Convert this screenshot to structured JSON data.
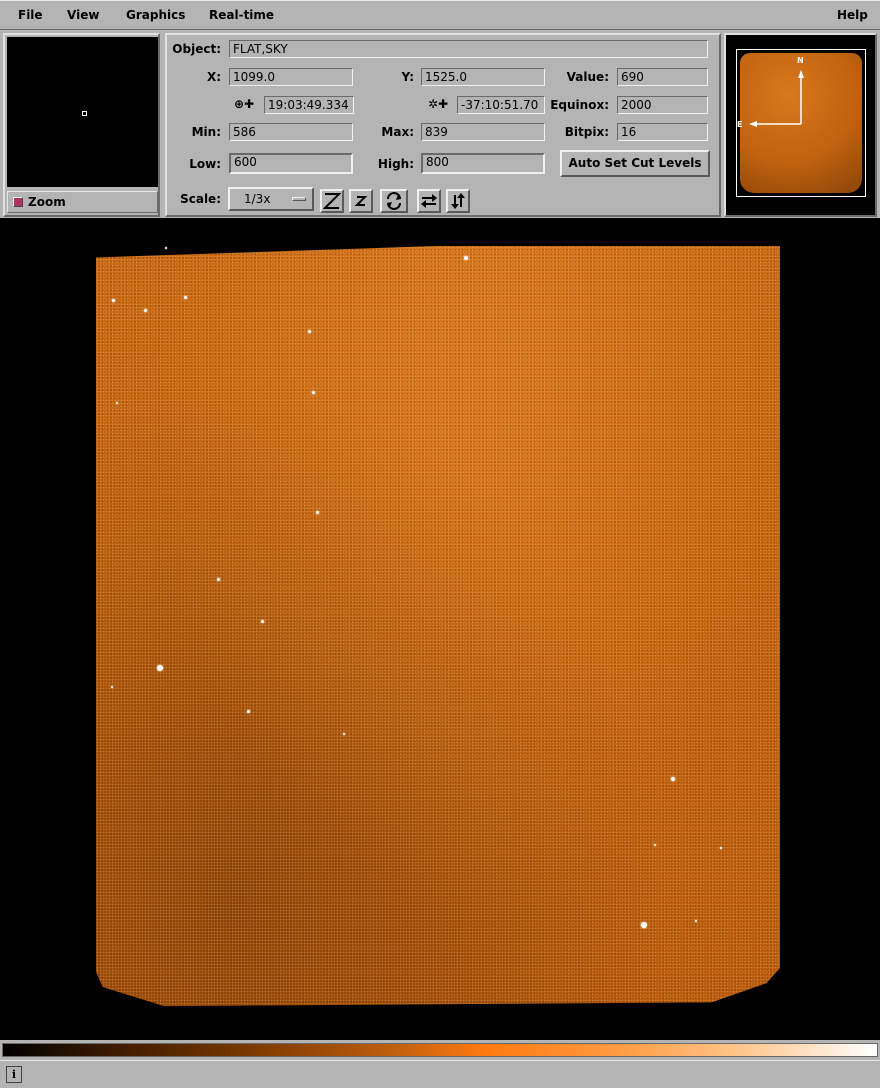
{
  "menu": {
    "file": "File",
    "view": "View",
    "graphics": "Graphics",
    "realtime": "Real-time",
    "help": "Help"
  },
  "zoom": {
    "label": "Zoom",
    "checked": true
  },
  "info": {
    "object_label": "Object:",
    "object_value": "FLAT,SKY",
    "x_label": "X:",
    "x_value": "1099.0",
    "y_label": "Y:",
    "y_value": "1525.0",
    "value_label": "Value:",
    "value_value": "690",
    "ra_value": "19:03:49.334",
    "dec_value": "-37:10:51.70",
    "equinox_label": "Equinox:",
    "equinox_value": "2000",
    "min_label": "Min:",
    "min_value": "586",
    "max_label": "Max:",
    "max_value": "839",
    "bitpix_label": "Bitpix:",
    "bitpix_value": "16",
    "low_label": "Low:",
    "low_value": "600",
    "high_label": "High:",
    "high_value": "800",
    "auto_cut_label": "Auto Set Cut Levels",
    "scale_label": "Scale:",
    "scale_value": "1/3x"
  },
  "panner": {
    "north_label": "N",
    "east_label": "E"
  },
  "colormap": {
    "start": "#000000",
    "mid": "#ff7a10",
    "end": "#ffffff"
  },
  "status": {
    "icon": "i",
    "text": ""
  },
  "icons": {
    "zoom_in": "zoom-in-icon",
    "zoom_out": "zoom-out-icon",
    "rotate": "rotate-icon",
    "flip_x": "flip-x-icon",
    "flip_y": "flip-y-icon"
  }
}
